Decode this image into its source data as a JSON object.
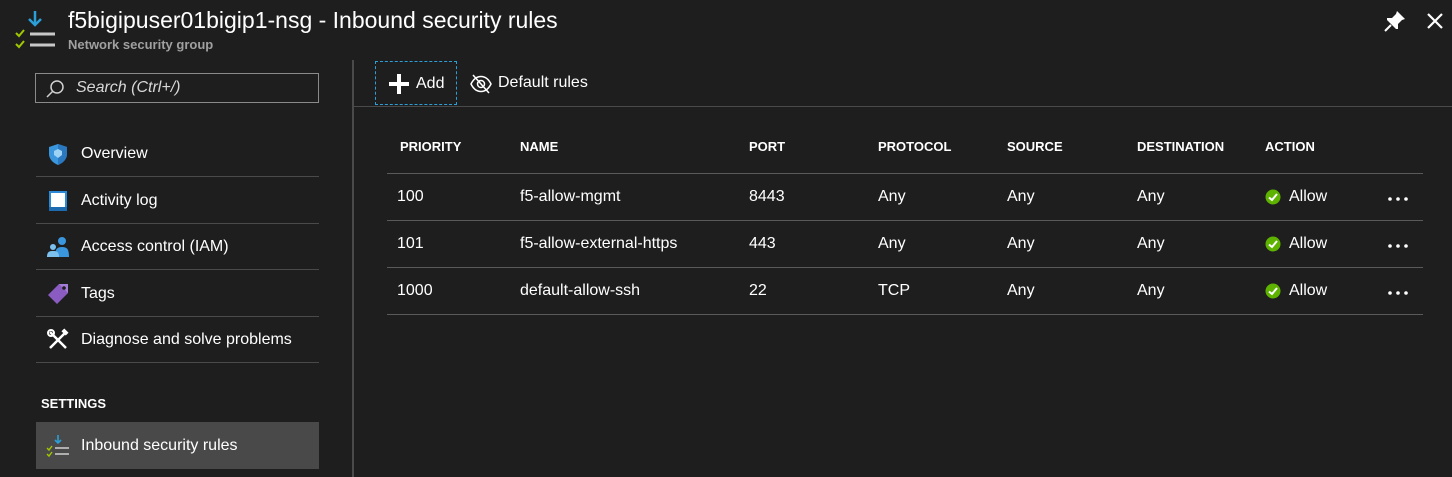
{
  "header": {
    "title": "f5bigipuser01bigip1-nsg - Inbound security rules",
    "subtitle": "Network security group"
  },
  "sidebar": {
    "search_placeholder": "Search (Ctrl+/)",
    "items": [
      {
        "label": "Overview",
        "icon": "shield-icon"
      },
      {
        "label": "Activity log",
        "icon": "activity-log-icon"
      },
      {
        "label": "Access control (IAM)",
        "icon": "people-icon"
      },
      {
        "label": "Tags",
        "icon": "tag-icon"
      },
      {
        "label": "Diagnose and solve problems",
        "icon": "wrench-icon"
      }
    ],
    "section_label": "SETTINGS",
    "active_item": {
      "label": "Inbound security rules",
      "icon": "inbound-rules-icon"
    }
  },
  "toolbar": {
    "add_label": "Add",
    "default_rules_label": "Default rules"
  },
  "table": {
    "columns": [
      "PRIORITY",
      "NAME",
      "PORT",
      "PROTOCOL",
      "SOURCE",
      "DESTINATION",
      "ACTION"
    ],
    "rows": [
      {
        "priority": "100",
        "name": "f5-allow-mgmt",
        "port": "8443",
        "protocol": "Any",
        "source": "Any",
        "destination": "Any",
        "action": "Allow"
      },
      {
        "priority": "101",
        "name": "f5-allow-external-https",
        "port": "443",
        "protocol": "Any",
        "source": "Any",
        "destination": "Any",
        "action": "Allow"
      },
      {
        "priority": "1000",
        "name": "default-allow-ssh",
        "port": "22",
        "protocol": "TCP",
        "source": "Any",
        "destination": "Any",
        "action": "Allow"
      }
    ]
  },
  "colors": {
    "background": "#1e1e1e",
    "accent_blue": "#2a9fd8",
    "allow_green": "#5db300",
    "active_item_bg": "#494949"
  }
}
